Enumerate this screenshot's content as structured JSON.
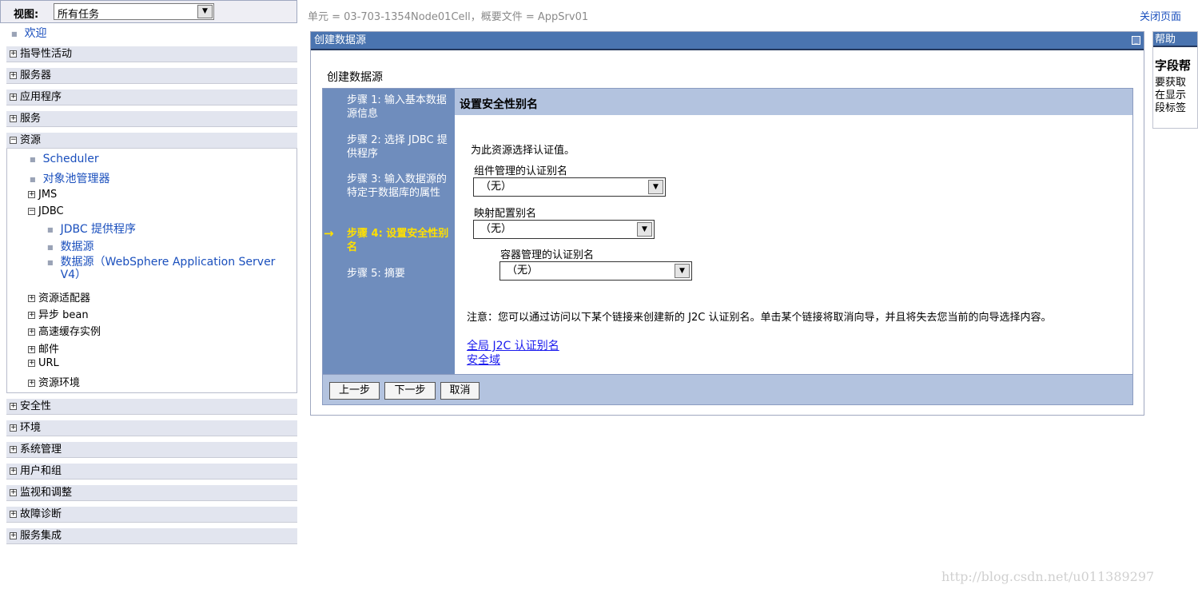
{
  "nav": {
    "view_label": "视图:",
    "view_value": "所有任务",
    "welcome": "欢迎",
    "sections_top": [
      "指导性活动",
      "服务器",
      "应用程序",
      "服务"
    ],
    "resources_label": "资源",
    "resources_items": {
      "scheduler": "Scheduler",
      "pool_manager": "对象池管理器",
      "jms": "JMS",
      "jdbc": "JDBC",
      "jdbc_provider": "JDBC 提供程序",
      "datasource": "数据源",
      "datasource_v4": "数据源（WebSphere Application Server V4）",
      "adapters": "资源适配器",
      "async_bean": "异步 bean",
      "cache": "高速缓存实例",
      "mail": "邮件",
      "url": "URL",
      "env": "资源环境"
    },
    "sections_bottom": [
      "安全性",
      "环境",
      "系统管理",
      "用户和组",
      "监视和调整",
      "故障诊断",
      "服务集成"
    ]
  },
  "breadcrumb": "单元 = 03-703-1354Node01Cell，概要文件 = AppSrv01",
  "close_page": "关闭页面",
  "portlet_title": "创建数据源",
  "wizard_heading": "创建数据源",
  "steps": [
    "步骤 1: 输入基本数据源信息",
    "步骤 2: 选择 JDBC 提供程序",
    "步骤 3: 输入数据源的特定于数据库的属性",
    "步骤 4: 设置安全性别名",
    "步骤 5: 摘要"
  ],
  "step_arrow": "→",
  "panel_title": "设置安全性别名",
  "instruction": "为此资源选择认证值。",
  "fields": {
    "component_label": "组件管理的认证别名",
    "component_value": "（无）",
    "mapping_label": "映射配置别名",
    "mapping_value": "（无）",
    "container_label": "容器管理的认证别名",
    "container_value": "（无）"
  },
  "note": "注意：您可以通过访问以下某个链接来创建新的 J2C 认证别名。单击某个链接将取消向导，并且将失去您当前的向导选择内容。",
  "links": {
    "global_j2c": "全局 J2C 认证别名",
    "security_domain": "安全域"
  },
  "buttons": {
    "prev": "上一步",
    "next": "下一步",
    "cancel": "取消"
  },
  "help": {
    "title": "帮助",
    "heading": "字段帮",
    "lines": [
      "要获取",
      "在显示",
      "段标签"
    ]
  },
  "watermark": "http://blog.csdn.net/u011389297",
  "colors": {
    "title_bar": "#4a74b0",
    "steps_bg": "#6f8dbd",
    "current_step": "#ffe000",
    "panel_bg": "#b3c3df",
    "link": "#1a1aee"
  }
}
